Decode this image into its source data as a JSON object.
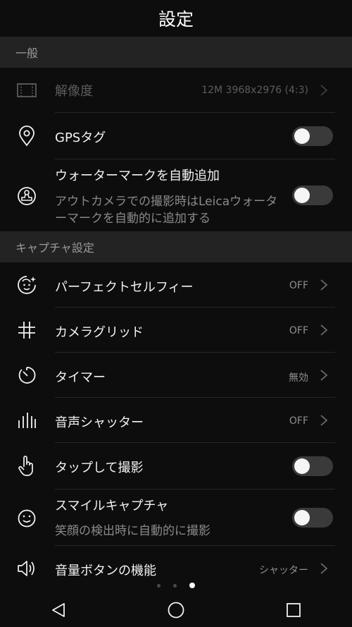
{
  "header": {
    "title": "設定"
  },
  "sections": {
    "general": "一般",
    "capture": "キャプチャ設定"
  },
  "rows": {
    "resolution": {
      "label": "解像度",
      "value": "12M 3968x2976 (4:3)",
      "icon": "resolution-frame-icon",
      "disabled": true
    },
    "gps_tag": {
      "label": "GPSタグ",
      "icon": "location-pin-icon",
      "toggle": false
    },
    "watermark": {
      "label": "ウォーターマークを自動追加",
      "sub": "アウトカメラでの撮影時はLeicaウォーターマークを自動的に追加する",
      "icon": "stamp-icon",
      "toggle": false
    },
    "perfect_selfie": {
      "label": "パーフェクトセルフィー",
      "value": "OFF",
      "icon": "selfie-face-icon"
    },
    "camera_grid": {
      "label": "カメラグリッド",
      "value": "OFF",
      "icon": "grid-icon"
    },
    "timer": {
      "label": "タイマー",
      "value": "無効",
      "icon": "timer-icon"
    },
    "audio_shutter": {
      "label": "音声シャッター",
      "value": "OFF",
      "icon": "audio-bars-icon"
    },
    "tap_capture": {
      "label": "タップして撮影",
      "icon": "tap-hand-icon",
      "toggle": false
    },
    "smile_capture": {
      "label": "スマイルキャプチャ",
      "sub": "笑顔の検出時に自動的に撮影",
      "icon": "smile-icon",
      "toggle": false
    },
    "volume_button": {
      "label": "音量ボタンの機能",
      "value": "シャッター",
      "icon": "speaker-icon"
    }
  },
  "pager": {
    "count": 3,
    "active_index": 2
  },
  "nav": {
    "back": "back-triangle-icon",
    "home": "home-circle-icon",
    "recents": "recents-square-icon"
  },
  "colors": {
    "background": "#0d0d0d",
    "section_header": "#232323",
    "toggle_track_off": "#3a3a3a"
  }
}
